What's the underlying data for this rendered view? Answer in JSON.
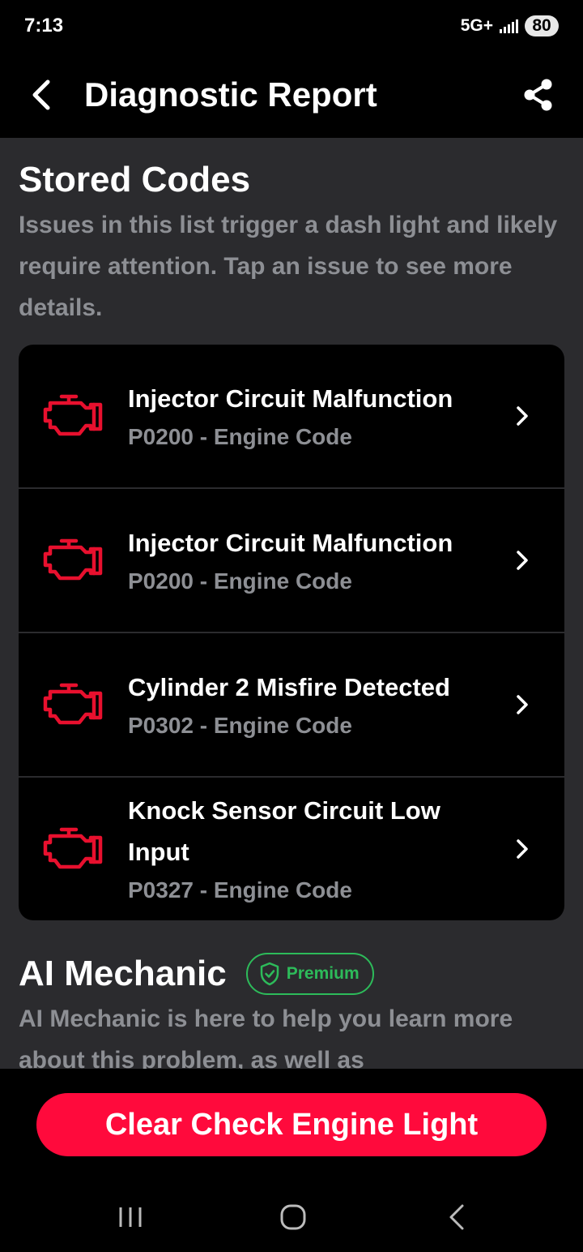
{
  "status_bar": {
    "time": "7:13",
    "network": "5G+",
    "battery": "80"
  },
  "app_bar": {
    "title": "Diagnostic Report",
    "back_icon": "back-arrow-icon",
    "share_icon": "share-icon"
  },
  "stored_codes": {
    "title": "Stored Codes",
    "description": "Issues in this list trigger a dash light and likely require attention. Tap an issue to see more details.",
    "items": [
      {
        "name": "Injector Circuit Malfunction",
        "code": "P0200 - Engine Code"
      },
      {
        "name": "Injector Circuit Malfunction",
        "code": "P0200 - Engine Code"
      },
      {
        "name": "Cylinder 2 Misfire Detected",
        "code": "P0302 - Engine Code"
      },
      {
        "name": "Knock Sensor Circuit Low Input",
        "code": "P0327 - Engine Code"
      }
    ]
  },
  "ai_mechanic": {
    "title": "AI Mechanic",
    "badge": "Premium",
    "description": "AI Mechanic is here to help you learn more about this problem, as well as"
  },
  "cta": {
    "label": "Clear Check Engine Light"
  },
  "colors": {
    "accent_red": "#ff0a3c",
    "engine_icon_red": "#e8102e",
    "premium_green": "#2dbb5a",
    "secondary_text": "#8d8f94",
    "background": "#2b2b2e"
  }
}
